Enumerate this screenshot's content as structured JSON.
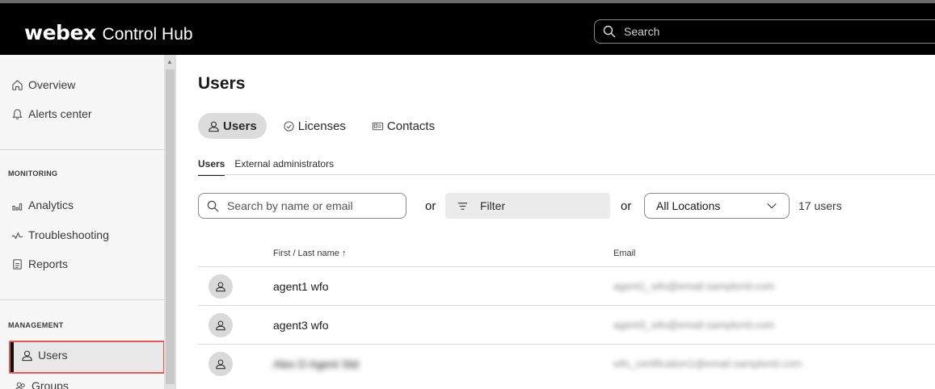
{
  "header": {
    "logo": "webex",
    "product": "Control Hub",
    "search_placeholder": "Search"
  },
  "sidebar": {
    "top_items": [
      {
        "label": "Overview",
        "icon": "home-icon"
      },
      {
        "label": "Alerts center",
        "icon": "bell-icon"
      }
    ],
    "monitoring": {
      "title": "MONITORING",
      "items": [
        {
          "label": "Analytics",
          "icon": "bar-chart-icon"
        },
        {
          "label": "Troubleshooting",
          "icon": "pulse-icon"
        },
        {
          "label": "Reports",
          "icon": "document-icon"
        }
      ]
    },
    "management": {
      "title": "MANAGEMENT",
      "items": [
        {
          "label": "Users",
          "icon": "user-icon",
          "active": true
        },
        {
          "label": "Groups",
          "icon": "group-icon"
        }
      ]
    }
  },
  "main": {
    "title": "Users",
    "pill_tabs": [
      {
        "label": "Users",
        "icon": "user-icon",
        "active": true
      },
      {
        "label": "Licenses",
        "icon": "check-circle-icon"
      },
      {
        "label": "Contacts",
        "icon": "contact-card-icon"
      }
    ],
    "subtabs": [
      {
        "label": "Users",
        "active": true
      },
      {
        "label": "External administrators"
      }
    ],
    "filters": {
      "search_placeholder": "Search by name or email",
      "or": "or",
      "filter_label": "Filter",
      "location_value": "All Locations",
      "count": "17 users"
    },
    "table": {
      "columns": [
        "First / Last name ↑",
        "Email"
      ],
      "rows": [
        {
          "name": "agent1 wfo",
          "email": "agent1_wfo@email.samplorid.com"
        },
        {
          "name": "agent3 wfo",
          "email": "agent3_wfo@email.samplorid.com"
        },
        {
          "name": "Alex D Agent Std",
          "email": "wfo_certification1@email.samplorid.com"
        }
      ]
    }
  },
  "colors": {
    "header_bg": "#000000",
    "highlight": "#e15a5a",
    "active_pill": "#dcdcdc"
  }
}
